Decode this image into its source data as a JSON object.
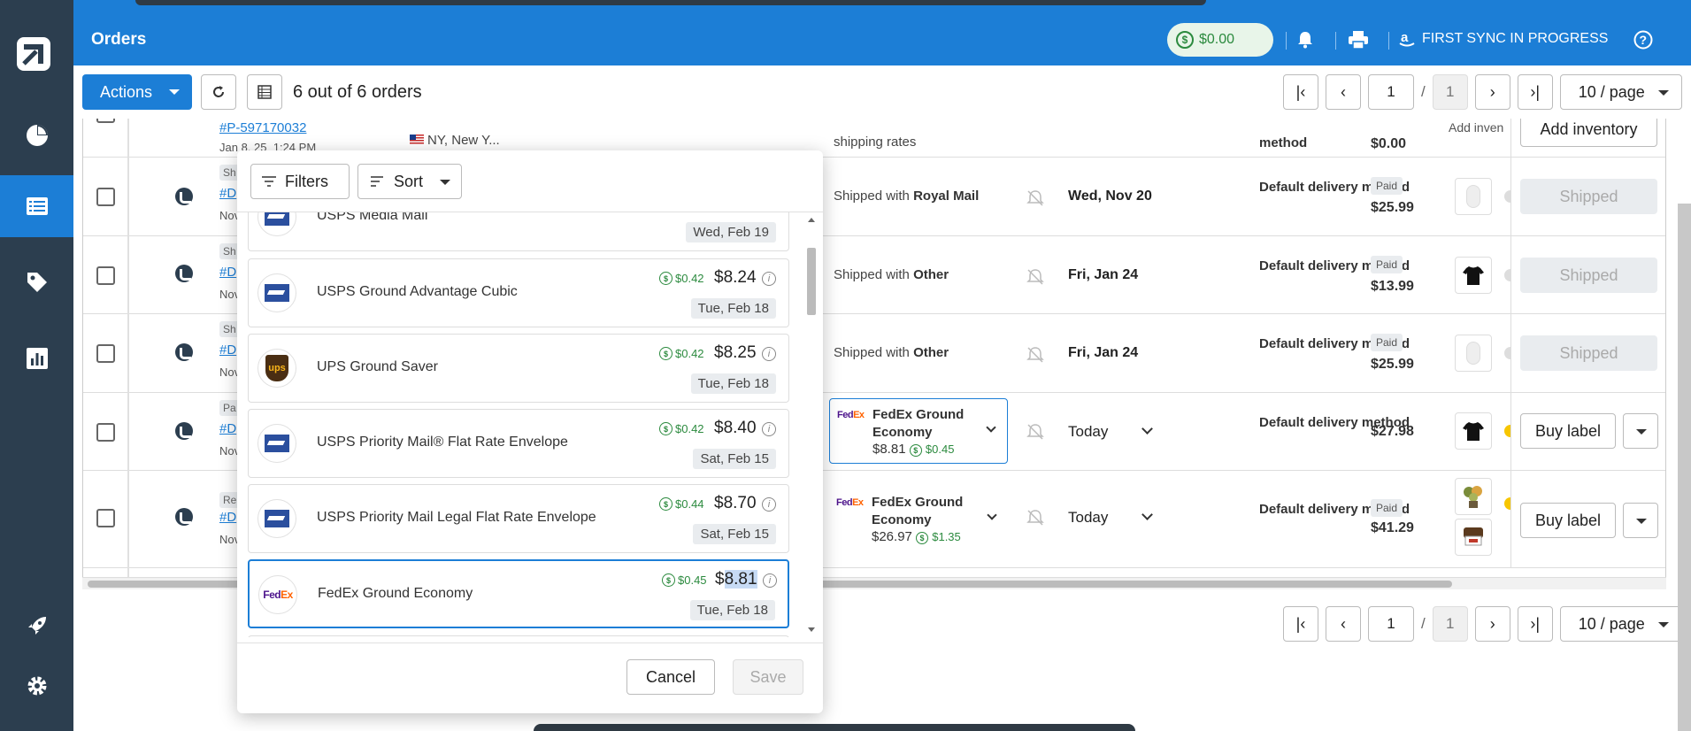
{
  "app": {
    "title": "Orders"
  },
  "header": {
    "balance": "$0.00",
    "sync_label": "FIRST SYNC IN PROGRESS"
  },
  "toolbar": {
    "actions_label": "Actions",
    "count_text": "6 out of 6 orders"
  },
  "pagination": {
    "page": "1",
    "total": "1",
    "slash": "/",
    "page_size": "10 / page"
  },
  "orders": [
    {
      "order_id": "#P-597170032",
      "date": "Jan 8, 25",
      "time": "1:24 PM",
      "location": "NY, New Y...",
      "shipping": "shipping rates",
      "method": "method",
      "amount": "$0.00",
      "inventory_label": "Add inventory",
      "inventory_partial": "Add inven"
    },
    {
      "tag": "Sh",
      "order_id": "#D",
      "sub": "Nov",
      "ship_prefix": "Shipped with",
      "ship_carrier": "Royal Mail",
      "date": "Wed, Nov 20",
      "method": "Default delivery method",
      "paid": "Paid",
      "amount": "$25.99",
      "action": "Shipped"
    },
    {
      "tag": "Sh",
      "order_id": "#D",
      "sub": "Nov",
      "ship_prefix": "Shipped with",
      "ship_carrier": "Other",
      "date": "Fri, Jan 24",
      "method": "Default delivery method",
      "paid": "Paid",
      "amount": "$13.99",
      "action": "Shipped"
    },
    {
      "tag": "Sh",
      "order_id": "#D",
      "sub": "Nov",
      "ship_prefix": "Shipped with",
      "ship_carrier": "Other",
      "date": "Fri, Jan 24",
      "method": "Default delivery method",
      "paid": "Paid",
      "amount": "$25.99",
      "action": "Shipped"
    },
    {
      "tag": "Pa",
      "order_id": "#D",
      "sub": "Nov",
      "carrier_name": "FedEx Ground Economy",
      "carrier_price": "$8.81",
      "carrier_cash": "$0.45",
      "date": "Today",
      "method": "Default delivery method",
      "amount": "$27.98",
      "action": "Buy label"
    },
    {
      "tag": "Re",
      "order_id": "#D",
      "sub": "Nov",
      "carrier_name": "FedEx Ground Economy",
      "carrier_price": "$26.97",
      "carrier_cash": "$1.35",
      "date": "Today",
      "method": "Default delivery method",
      "paid": "Paid",
      "amount": "$41.29",
      "action": "Buy label"
    }
  ],
  "popup": {
    "filters_label": "Filters",
    "sort_label": "Sort",
    "cancel_label": "Cancel",
    "save_label": "Save",
    "services": [
      {
        "name": "USPS Media Mail",
        "date": "Wed, Feb 19",
        "carrier": "usps"
      },
      {
        "name": "USPS Ground Advantage Cubic",
        "cash": "$0.42",
        "price": "$8.24",
        "date": "Tue, Feb 18",
        "carrier": "usps"
      },
      {
        "name": "UPS Ground Saver",
        "cash": "$0.42",
        "price": "$8.25",
        "date": "Tue, Feb 18",
        "carrier": "ups"
      },
      {
        "name": "USPS Priority Mail® Flat Rate Envelope",
        "cash": "$0.42",
        "price": "$8.40",
        "date": "Sat, Feb 15",
        "carrier": "usps"
      },
      {
        "name": "USPS Priority Mail Legal Flat Rate Envelope",
        "cash": "$0.44",
        "price": "$8.70",
        "date": "Sat, Feb 15",
        "carrier": "usps"
      },
      {
        "name": "FedEx Ground Economy",
        "cash": "$0.45",
        "price_prefix": "$",
        "price_highlight": "8.81",
        "date": "Tue, Feb 18",
        "carrier": "fedex",
        "selected": true
      }
    ]
  },
  "logos": {
    "fedex_fe": "Fed",
    "fedex_ex": "Ex",
    "ups": "ups",
    "dollar": "$"
  }
}
